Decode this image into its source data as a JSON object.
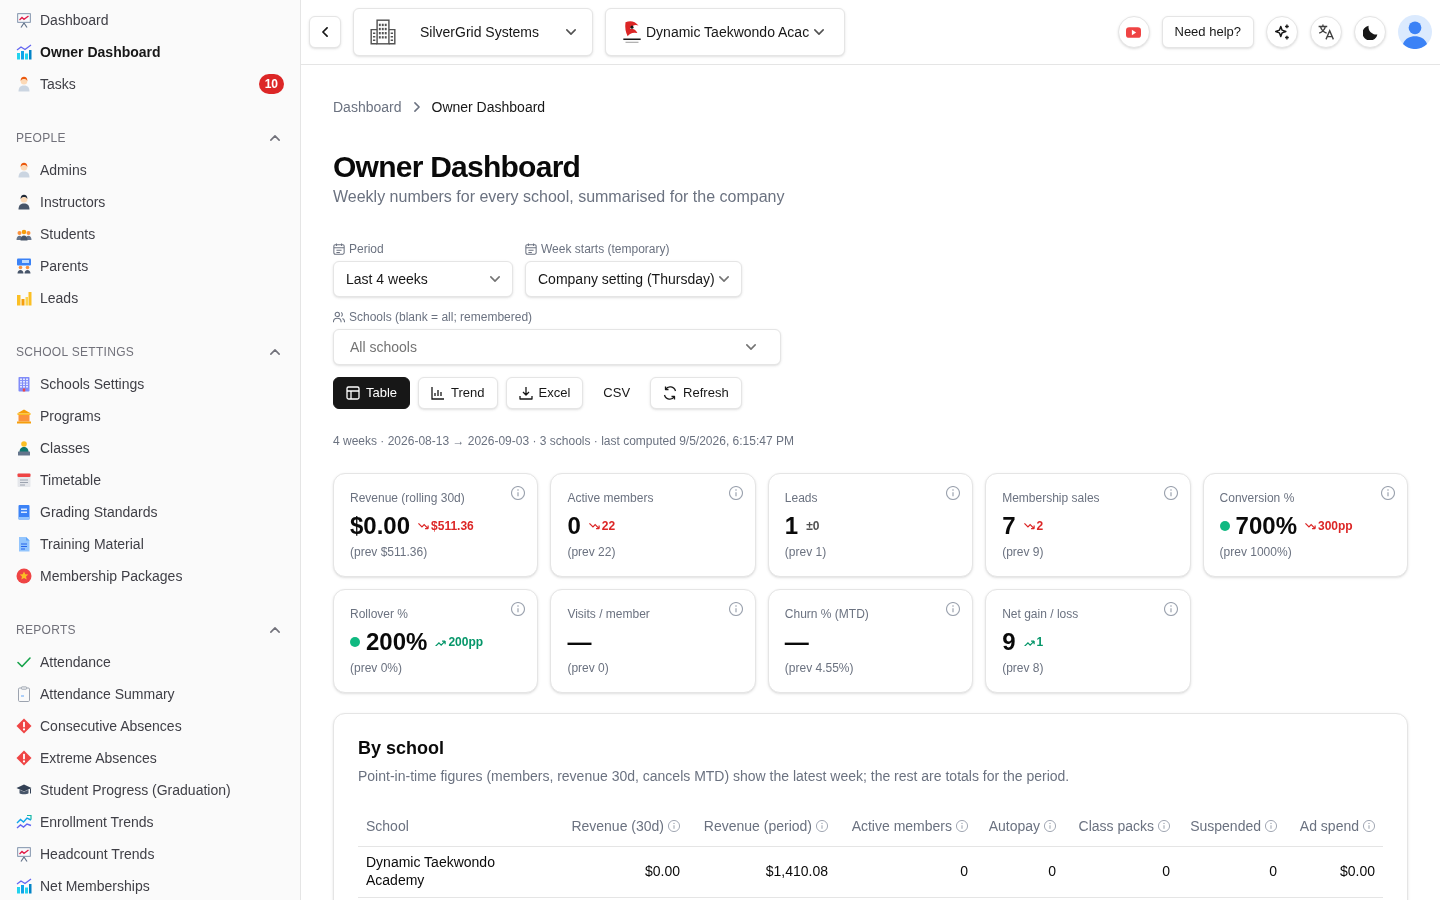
{
  "sidebar": {
    "items": [
      {
        "label": "Dashboard",
        "selected": false
      },
      {
        "label": "Owner Dashboard",
        "selected": true
      },
      {
        "label": "Tasks",
        "selected": false,
        "badge": "10"
      }
    ],
    "sections": [
      {
        "title": "PEOPLE",
        "expanded": true,
        "items": [
          {
            "label": "Admins",
            "selected": false
          },
          {
            "label": "Instructors",
            "selected": false
          },
          {
            "label": "Students",
            "selected": false
          },
          {
            "label": "Parents",
            "selected": false
          },
          {
            "label": "Leads",
            "selected": false
          }
        ]
      },
      {
        "title": "SCHOOL SETTINGS",
        "expanded": true,
        "items": [
          {
            "label": "Schools Settings",
            "selected": false
          },
          {
            "label": "Programs",
            "selected": false
          },
          {
            "label": "Classes",
            "selected": false
          },
          {
            "label": "Timetable",
            "selected": false
          },
          {
            "label": "Grading Standards",
            "selected": false
          },
          {
            "label": "Training Material",
            "selected": false
          },
          {
            "label": "Membership Packages",
            "selected": false
          }
        ]
      },
      {
        "title": "REPORTS",
        "expanded": true,
        "items": [
          {
            "label": "Attendance",
            "selected": false
          },
          {
            "label": "Attendance Summary",
            "selected": false
          },
          {
            "label": "Consecutive Absences",
            "selected": false
          },
          {
            "label": "Extreme Absences",
            "selected": false
          },
          {
            "label": "Student Progress (Graduation)",
            "selected": false
          },
          {
            "label": "Enrollment Trends",
            "selected": false
          },
          {
            "label": "Headcount Trends",
            "selected": false
          },
          {
            "label": "Net Memberships",
            "selected": false
          }
        ]
      }
    ]
  },
  "topbar": {
    "company": "SilverGrid Systems",
    "school": "Dynamic Taekwondo Acac",
    "help_button": "Need help?"
  },
  "breadcrumb": [
    {
      "label": "Dashboard",
      "current": false
    },
    {
      "label": "Owner Dashboard",
      "current": true
    }
  ],
  "page": {
    "title": "Owner Dashboard",
    "subtitle": "Weekly numbers for every school, summarised for the company"
  },
  "filters": {
    "period": {
      "label": "Period",
      "value": "Last 4 weeks"
    },
    "week_start": {
      "label": "Week starts (temporary)",
      "value": "Company setting (Thursday)"
    },
    "schools": {
      "label": "Schools (blank = all; remembered)",
      "placeholder": "All schools"
    }
  },
  "toolbar": [
    {
      "kind": "view",
      "label": "Table",
      "selected": true
    },
    {
      "kind": "view",
      "label": "Trend",
      "selected": false
    },
    {
      "kind": "action",
      "label": "Excel"
    },
    {
      "kind": "link",
      "label": "CSV"
    },
    {
      "kind": "action",
      "label": "Refresh"
    }
  ],
  "summary": "4 weeks · 2026-08-13 → 2026-09-03 · 3 schools · last computed 9/5/2026, 6:15:47 PM",
  "kpis": [
    {
      "label": "Revenue (rolling 30d)",
      "value": "$0.00",
      "delta": {
        "text": "$511.36",
        "kind": "down"
      },
      "prev": "(prev $511.36)"
    },
    {
      "label": "Active members",
      "value": "0",
      "delta": {
        "text": "22",
        "kind": "down"
      },
      "prev": "(prev 22)"
    },
    {
      "label": "Leads",
      "value": "1",
      "delta": {
        "text": "±0",
        "kind": "flat"
      },
      "prev": "(prev 1)"
    },
    {
      "label": "Membership sales",
      "value": "7",
      "delta": {
        "text": "2",
        "kind": "down"
      },
      "prev": "(prev 9)"
    },
    {
      "label": "Conversion %",
      "value": "700%",
      "color": "#10b981",
      "delta": {
        "text": "300pp",
        "kind": "down"
      },
      "prev": "(prev 1000%)"
    },
    {
      "label": "Rollover %",
      "value": "200%",
      "color": "#10b981",
      "delta": {
        "text": "200pp",
        "kind": "up"
      },
      "prev": "(prev 0%)"
    },
    {
      "label": "Visits / member",
      "value": "—",
      "prev": "(prev 0)"
    },
    {
      "label": "Churn % (MTD)",
      "value": "—",
      "prev": "(prev 4.55%)"
    },
    {
      "label": "Net gain / loss",
      "value": "9",
      "delta": {
        "text": "1",
        "kind": "up"
      },
      "prev": "(prev 8)"
    }
  ],
  "by_school": {
    "title": "By school",
    "description": "Point-in-time figures (members, revenue 30d, cancels MTD) show the latest week; the rest are totals for the period.",
    "columns": [
      {
        "label": "School",
        "info": false
      },
      {
        "label": "Revenue (30d)",
        "info": true
      },
      {
        "label": "Revenue (period)",
        "info": true
      },
      {
        "label": "Active members",
        "info": true
      },
      {
        "label": "Autopay",
        "info": true
      },
      {
        "label": "Class packs",
        "info": true
      },
      {
        "label": "Suspended",
        "info": true
      },
      {
        "label": "Ad spend",
        "info": true
      }
    ],
    "rows": [
      [
        "Dynamic Taekwondo Academy",
        "$0.00",
        "$1,410.08",
        "0",
        "0",
        "0",
        "0",
        "$0.00"
      ]
    ]
  }
}
